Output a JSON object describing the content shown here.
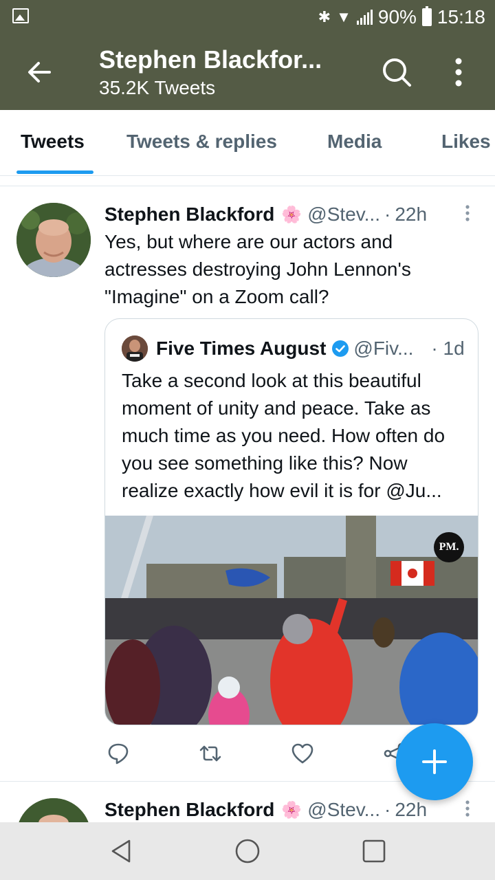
{
  "status_bar": {
    "battery": "90%",
    "time": "15:18"
  },
  "header": {
    "title": "Stephen Blackfor...",
    "subtitle": "35.2K Tweets"
  },
  "tabs": [
    {
      "label": "Tweets",
      "active": true
    },
    {
      "label": "Tweets & replies",
      "active": false
    },
    {
      "label": "Media",
      "active": false
    },
    {
      "label": "Likes",
      "active": false
    }
  ],
  "tweet": {
    "name": "Stephen Blackford",
    "emoji": "🌸",
    "handle": "@Stev...",
    "separator": "·",
    "time": "22h",
    "text": "Yes, but where are our actors and actresses destroying John Lennon's \"Imagine\" on a Zoom call?",
    "quote": {
      "name": "Five Times August",
      "handle": "@Fiv...",
      "separator": "·",
      "time": "1d",
      "text": "Take a second look at this beautiful moment of unity and peace. Take as much time as you need. How often do you see something like this? Now realize exactly how evil it is for @Ju...",
      "media_badge": "PM."
    }
  },
  "next_tweet": {
    "name": "Stephen Blackford",
    "emoji": "🌸",
    "handle": "@Stev...",
    "separator": "·",
    "time": "22h"
  },
  "colors": {
    "header_bg": "#545b45",
    "accent": "#1d9bf0",
    "secondary_text": "#536471"
  }
}
